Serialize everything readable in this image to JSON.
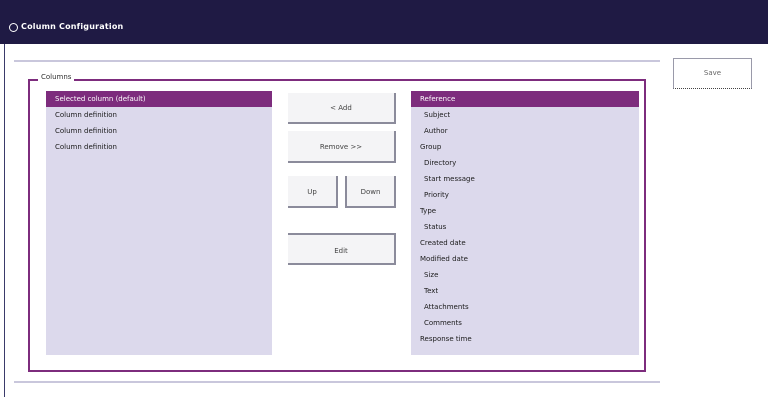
{
  "window": {
    "title": "Column Configuration"
  },
  "panel": {
    "legend": "Columns"
  },
  "left_list": {
    "items": [
      {
        "label": "Selected column (default)",
        "selected": true
      },
      {
        "label": "Column definition",
        "selected": false
      },
      {
        "label": "Column definition",
        "selected": false
      },
      {
        "label": "Column definition",
        "selected": false
      }
    ]
  },
  "buttons": {
    "add": "< Add",
    "remove": "Remove >>",
    "up": "Up",
    "down": "Down",
    "edit": "Edit",
    "save": "Save"
  },
  "right_list": {
    "items": [
      {
        "label": "Reference",
        "selected": true,
        "indent": false
      },
      {
        "label": "Subject",
        "indent": true
      },
      {
        "label": "Author",
        "indent": true
      },
      {
        "label": "Group",
        "indent": false
      },
      {
        "label": "Directory",
        "indent": true
      },
      {
        "label": "Start message",
        "indent": true
      },
      {
        "label": "Priority",
        "indent": true
      },
      {
        "label": "Type",
        "indent": false
      },
      {
        "label": "Status",
        "indent": true
      },
      {
        "label": "Created date",
        "indent": false
      },
      {
        "label": "Modified date",
        "indent": false
      },
      {
        "label": "Size",
        "indent": true
      },
      {
        "label": "Text",
        "indent": true
      },
      {
        "label": "Attachments",
        "indent": true
      },
      {
        "label": "Comments",
        "indent": true
      },
      {
        "label": "Response time",
        "indent": false
      }
    ]
  },
  "colors": {
    "title_bar": "#1f1a44",
    "accent": "#7d2c7d",
    "list_bg": "#dcd9ec"
  }
}
